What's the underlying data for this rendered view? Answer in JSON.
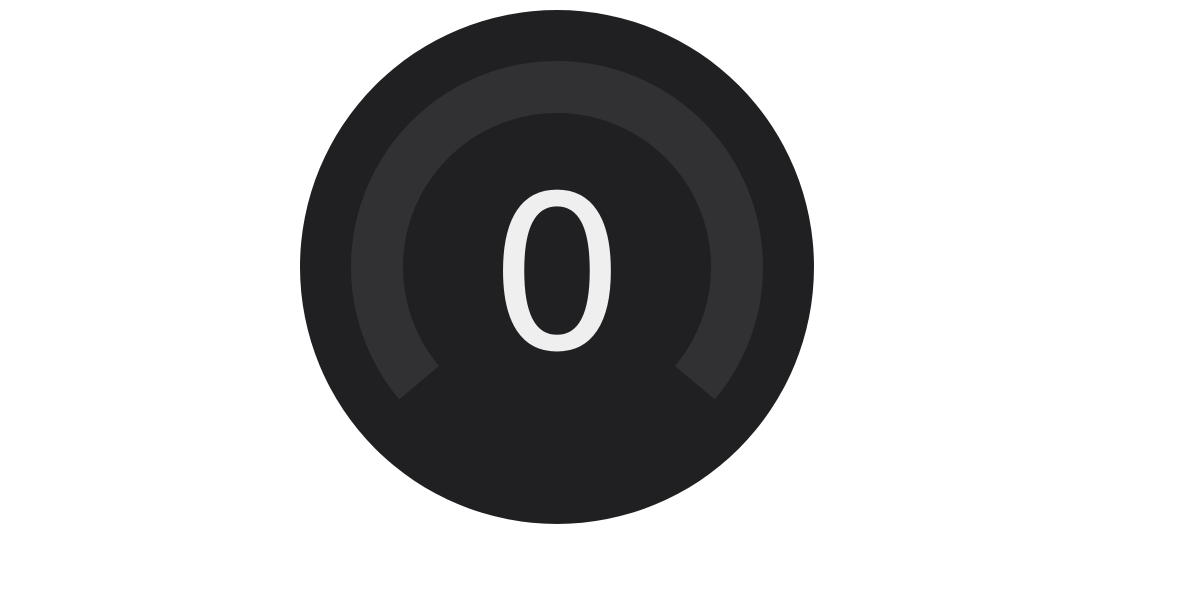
{
  "gauge": {
    "value_text": "0",
    "value": 0,
    "min": 0,
    "max": 100,
    "colors": {
      "face": "#202022",
      "track": "#313133",
      "fill": "#5a9cf8",
      "text": "#efefef"
    }
  }
}
